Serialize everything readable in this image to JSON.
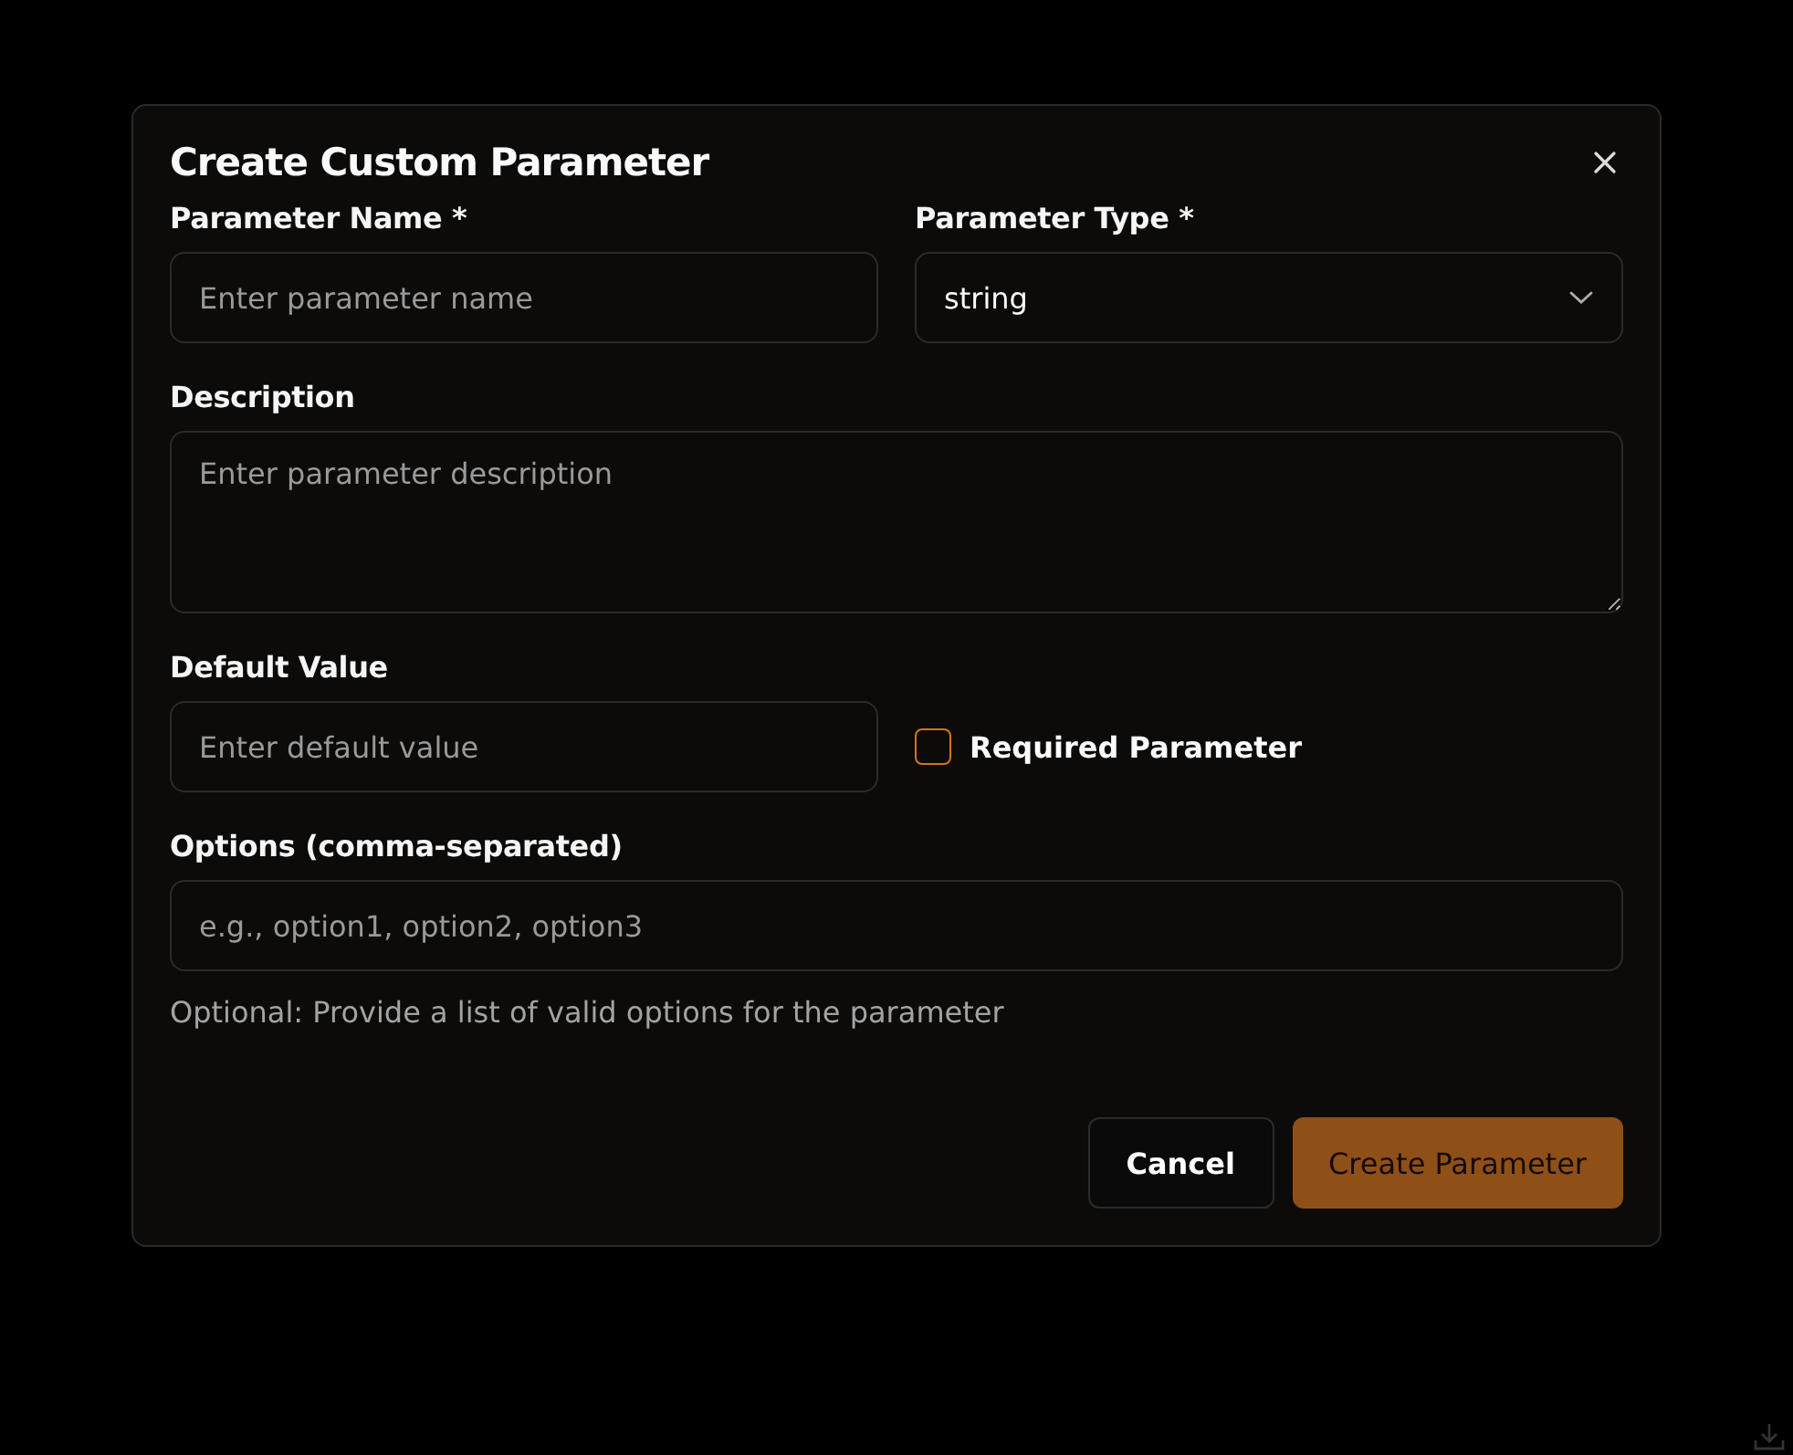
{
  "dialog": {
    "title": "Create Custom Parameter",
    "name_field": {
      "label": "Parameter Name *",
      "placeholder": "Enter parameter name"
    },
    "type_field": {
      "label": "Parameter Type *",
      "value": "string"
    },
    "description_field": {
      "label": "Description",
      "placeholder": "Enter parameter description"
    },
    "default_field": {
      "label": "Default Value",
      "placeholder": "Enter default value"
    },
    "required_checkbox": {
      "label": "Required Parameter",
      "checked": false
    },
    "options_field": {
      "label": "Options (comma-separated)",
      "placeholder": "e.g., option1, option2, option3",
      "hint": "Optional: Provide a list of valid options for the parameter"
    },
    "buttons": [
      {
        "label": "Cancel",
        "kind": "secondary",
        "disabled": false
      },
      {
        "label": "Create Parameter",
        "kind": "primary",
        "disabled": true
      }
    ]
  }
}
